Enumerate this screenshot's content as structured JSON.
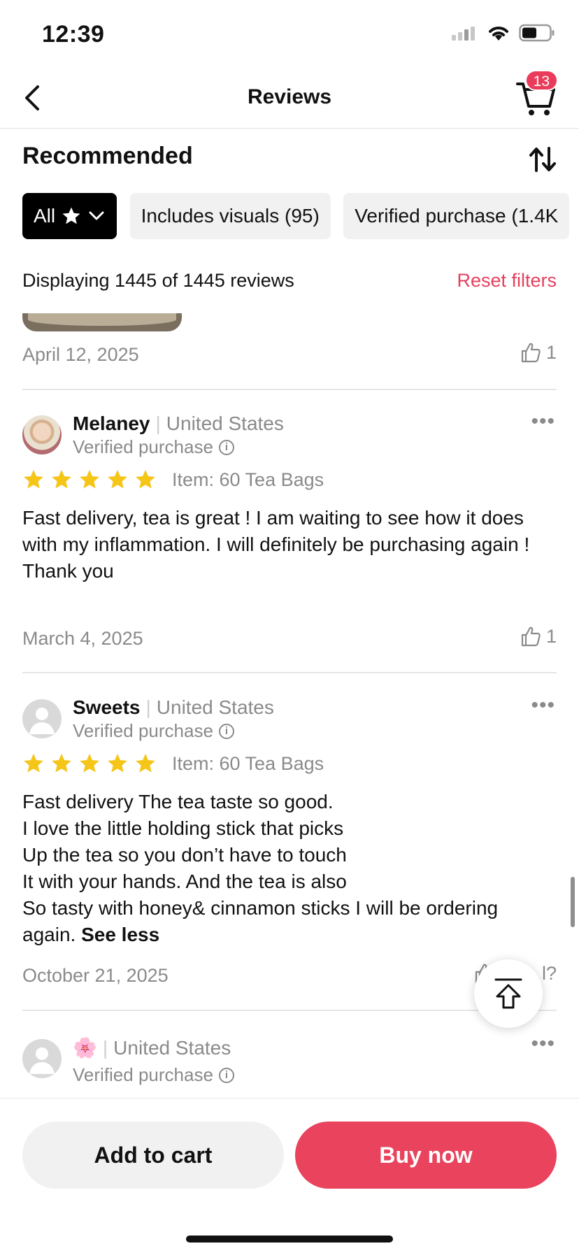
{
  "status_bar": {
    "time": "12:39"
  },
  "nav": {
    "title": "Reviews",
    "cart_count": "13"
  },
  "sort": {
    "label": "Recommended"
  },
  "filters": {
    "all_label": "All",
    "chips": [
      "Includes visuals (95)",
      "Verified purchase (1.4K"
    ]
  },
  "summary": {
    "displaying": "Displaying 1445 of 1445 reviews",
    "reset": "Reset filters"
  },
  "prev_review": {
    "date": "April 12, 2025",
    "likes": "1"
  },
  "reviews": [
    {
      "name": "Melaney",
      "country": "United States",
      "verified": "Verified purchase",
      "rating": 5,
      "item": "Item: 60 Tea Bags",
      "text": "Fast delivery, tea is great ! I am waiting to see how it does with my inflammation. I will definitely be purchasing again !\nThank you",
      "date": "March 4, 2025",
      "likes": "1"
    },
    {
      "name": "Sweets",
      "country": "United States",
      "verified": "Verified purchase",
      "rating": 5,
      "item": "Item: 60 Tea Bags",
      "text": "Fast delivery The tea taste so good.\nI love the little holding stick that picks\nUp the tea so you don’t have to touch\nIt with your hands. And the tea is also\nSo tasty with honey& cinnamon sticks I will be ordering again.",
      "see_less": "See less",
      "date": "October 21, 2025",
      "helpful_fragment": "l?"
    },
    {
      "name": "🌸",
      "country": "United States",
      "verified": "Verified purchase"
    }
  ],
  "bottom": {
    "add_to_cart": "Add to cart",
    "buy_now": "Buy now"
  },
  "colors": {
    "accent": "#e9435d",
    "star": "#f5c518",
    "muted": "#8a8a8a"
  }
}
